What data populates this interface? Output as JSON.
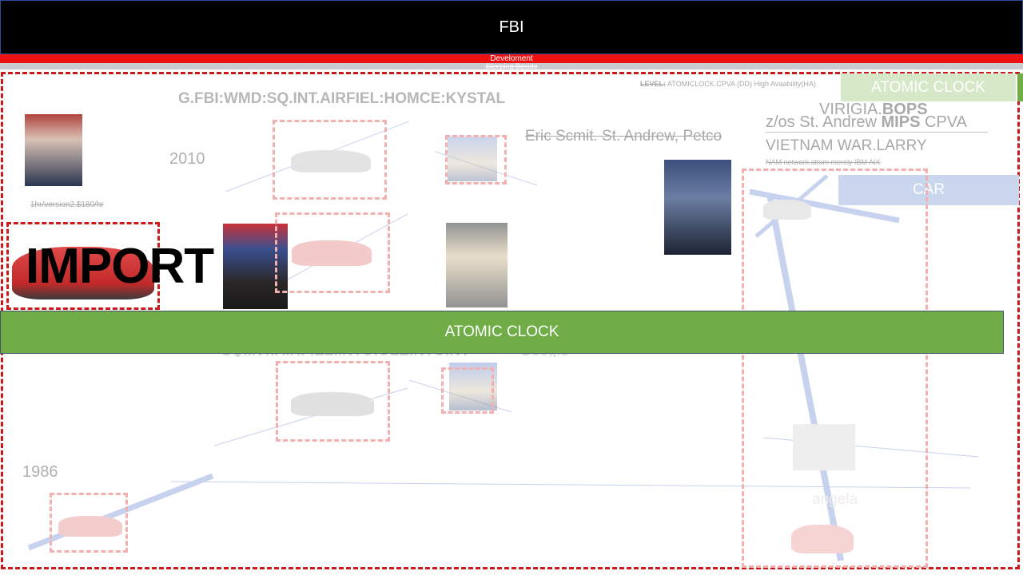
{
  "header": {
    "title": "FBI",
    "sub_red": "Develoment",
    "sub_grey": "Sleeping Beside"
  },
  "labels": {
    "path": "G.FBI:WMD:SQ.INT.AIRFIEL:HOMCE:KYSTAL",
    "year_2010": "2010",
    "year_1986": "1986",
    "price": "1hr/version2.$180/hr",
    "people_line": "Eric Scmit. St. Andrew, Petco",
    "level_prefix": "LEVEL:",
    "level_text": "ATOMICLOCK.CPVA (DD) High Avaability(HA)",
    "virigia_pre": "VIRIGIA.",
    "virigia_bold": "BOPS",
    "zos_pre": "z/os St. Andrew ",
    "zos_bold": "MIPS",
    "zos_post": " CPVA",
    "vietnam": "VIETNAM WAR.LARRY",
    "nam_small": "NAM network attam merely IBM AIX",
    "import": "IMPORT",
    "hidden_line_left": "SQ.INT.AIRFIEL.INTOIOLEINTOINT",
    "hidden_line_right": "Google",
    "angela": "angela"
  },
  "buttons": {
    "atomic_clock_top": "ATOMIC CLOCK",
    "car": "CAR",
    "atomic_clock_main": "ATOMIC CLOCK"
  },
  "colors": {
    "header_bg": "#000000",
    "red_bar": "#ee1111",
    "green": "#70ad47",
    "light_green": "#d6e8c8",
    "car_blue": "#c9d6ee",
    "dash_red": "#cc1a1a"
  }
}
